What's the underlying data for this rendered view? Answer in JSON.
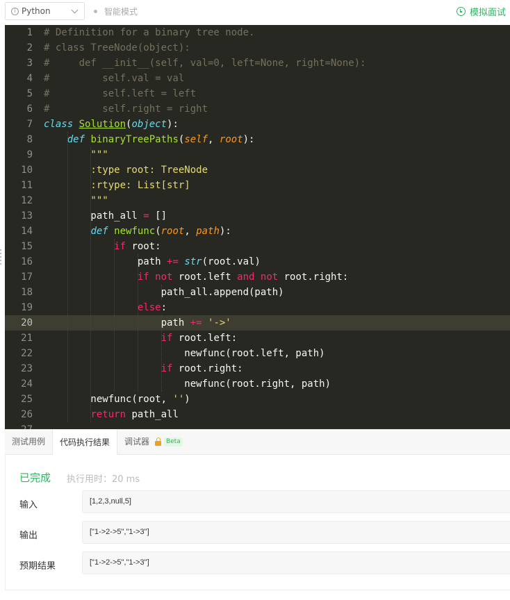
{
  "toolbar": {
    "language": "Python",
    "smart_mode": "智能模式",
    "mock_interview": "模拟面试"
  },
  "editor": {
    "active_line": 20,
    "lines": [
      "# Definition for a binary tree node.",
      "# class TreeNode(object):",
      "#     def __init__(self, val=0, left=None, right=None):",
      "#         self.val = val",
      "#         self.left = left",
      "#         self.right = right",
      "class Solution(object):",
      "    def binaryTreePaths(self, root):",
      "        \"\"\"",
      "        :type root: TreeNode",
      "        :rtype: List[str]",
      "        \"\"\"",
      "        path_all = []",
      "        def newfunc(root, path):",
      "            if root:",
      "                path += str(root.val)",
      "                if not root.left and not root.right:",
      "                    path_all.append(path)",
      "                else:",
      "                    path += '->'",
      "                    if root.left:",
      "                        newfunc(root.left, path)",
      "                    if root.right:",
      "                        newfunc(root.right, path)",
      "        newfunc(root, '')",
      "        return path_all",
      ""
    ]
  },
  "tabs": [
    {
      "label": "测试用例"
    },
    {
      "label": "代码执行结果"
    },
    {
      "label": "调试器"
    }
  ],
  "beta_label": "Beta",
  "result": {
    "status": "已完成",
    "elapsed": "执行用时：20 ms",
    "input_label": "输入",
    "input_value": "[1,2,3,null,5]",
    "output_label": "输出",
    "output_value": "[\"1->2->5\",\"1->3\"]",
    "expected_label": "预期结果",
    "expected_value": "[\"1->2->5\",\"1->3\"]"
  },
  "colors": {
    "accent_green": "#2db55d",
    "editor_bg": "#272822",
    "active_line_bg": "#3e3d32"
  }
}
